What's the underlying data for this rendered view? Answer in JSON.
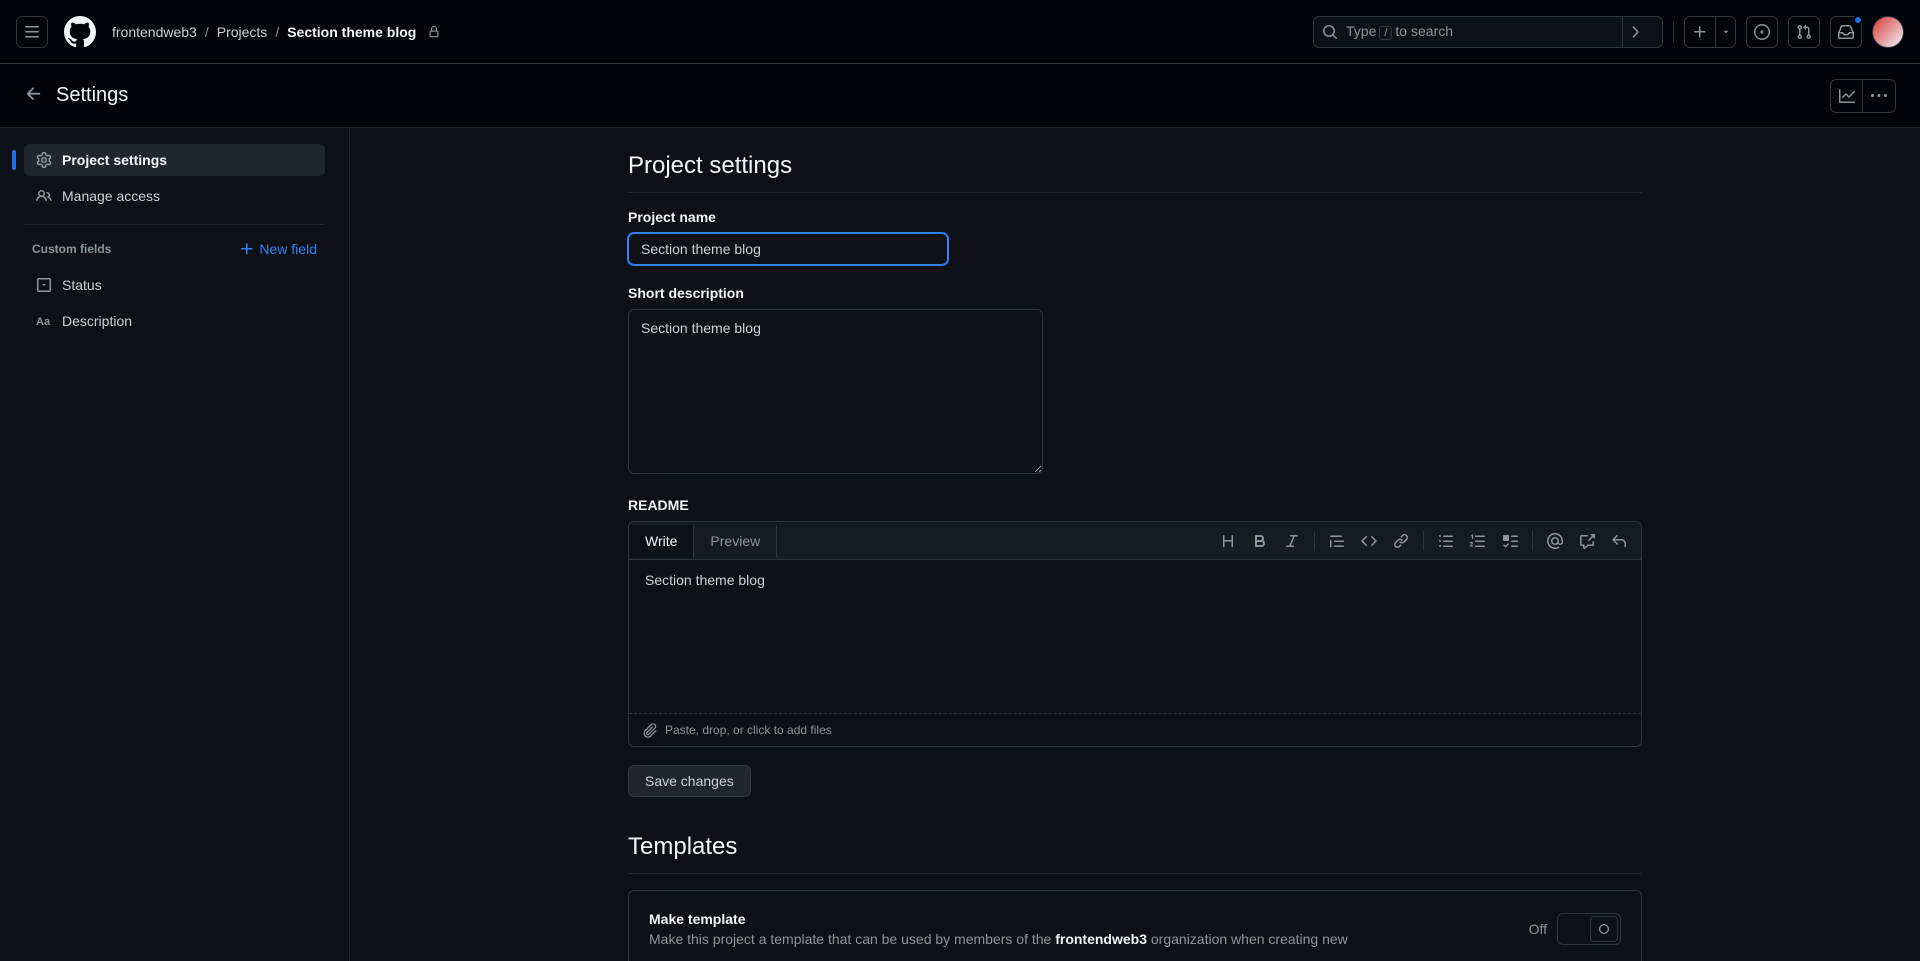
{
  "header": {
    "breadcrumbs": {
      "org": "frontendweb3",
      "projects": "Projects",
      "current": "Section theme blog"
    },
    "search": {
      "type_label": "Type",
      "key": "/",
      "suffix": "to search"
    }
  },
  "subheader": {
    "title": "Settings"
  },
  "sidebar": {
    "project_settings": "Project settings",
    "manage_access": "Manage access",
    "custom_fields_label": "Custom fields",
    "new_field": "New field",
    "fields": {
      "status": "Status",
      "description": "Description"
    }
  },
  "main": {
    "title": "Project settings",
    "project_name": {
      "label": "Project name",
      "value": "Section theme blog"
    },
    "short_description": {
      "label": "Short description",
      "value": "Section theme blog"
    },
    "readme": {
      "label": "README",
      "tabs": {
        "write": "Write",
        "preview": "Preview"
      },
      "value": "Section theme blog",
      "footer": "Paste, drop, or click to add files"
    },
    "save_button": "Save changes",
    "templates": {
      "title": "Templates",
      "box": {
        "heading": "Make template",
        "text_before": "Make this project a template that can be used by members of the ",
        "org": "frontendweb3",
        "text_after": " organization when creating new",
        "toggle_label": "Off"
      }
    }
  }
}
